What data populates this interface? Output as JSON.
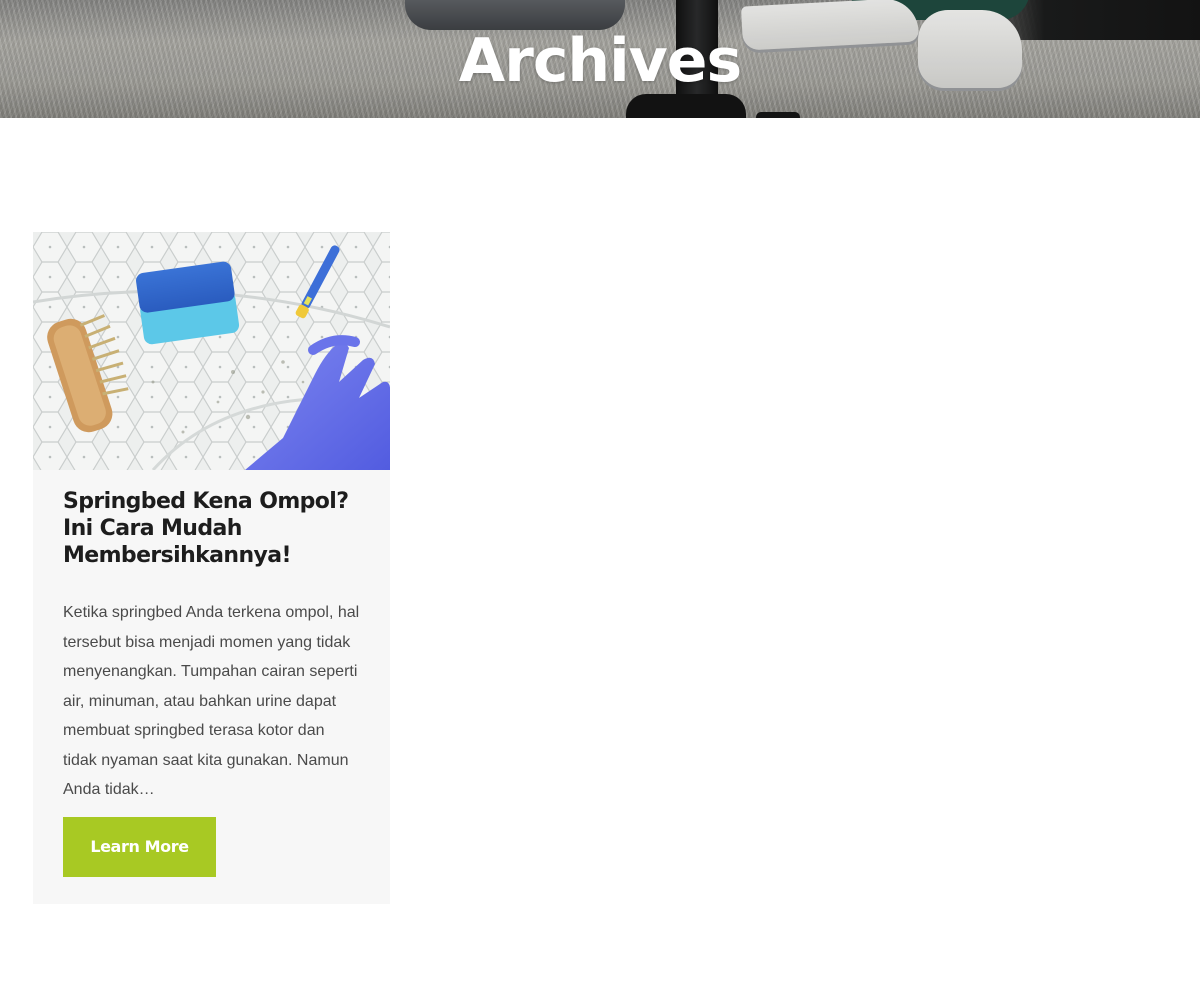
{
  "hero": {
    "title": "Archives",
    "background_image": "carpet-vacuum-photo"
  },
  "posts": [
    {
      "thumbnail": "springbed-cleaning-photo",
      "title": "Springbed Kena Ompol? Ini Cara Mudah Membersihkannya!",
      "excerpt": "Ketika springbed Anda terkena ompol, hal tersebut bisa menjadi momen yang tidak menyenangkan. Tumpahan cairan seperti air, minuman, atau bahkan urine dapat membuat springbed terasa kotor dan tidak nyaman saat kita gunakan. Namun Anda tidak…",
      "button_label": "Learn More"
    }
  ],
  "colors": {
    "button": "#a8c923",
    "card_background": "#f7f7f7",
    "title_text": "#1d1d1d",
    "body_text": "#4a4a4a"
  }
}
